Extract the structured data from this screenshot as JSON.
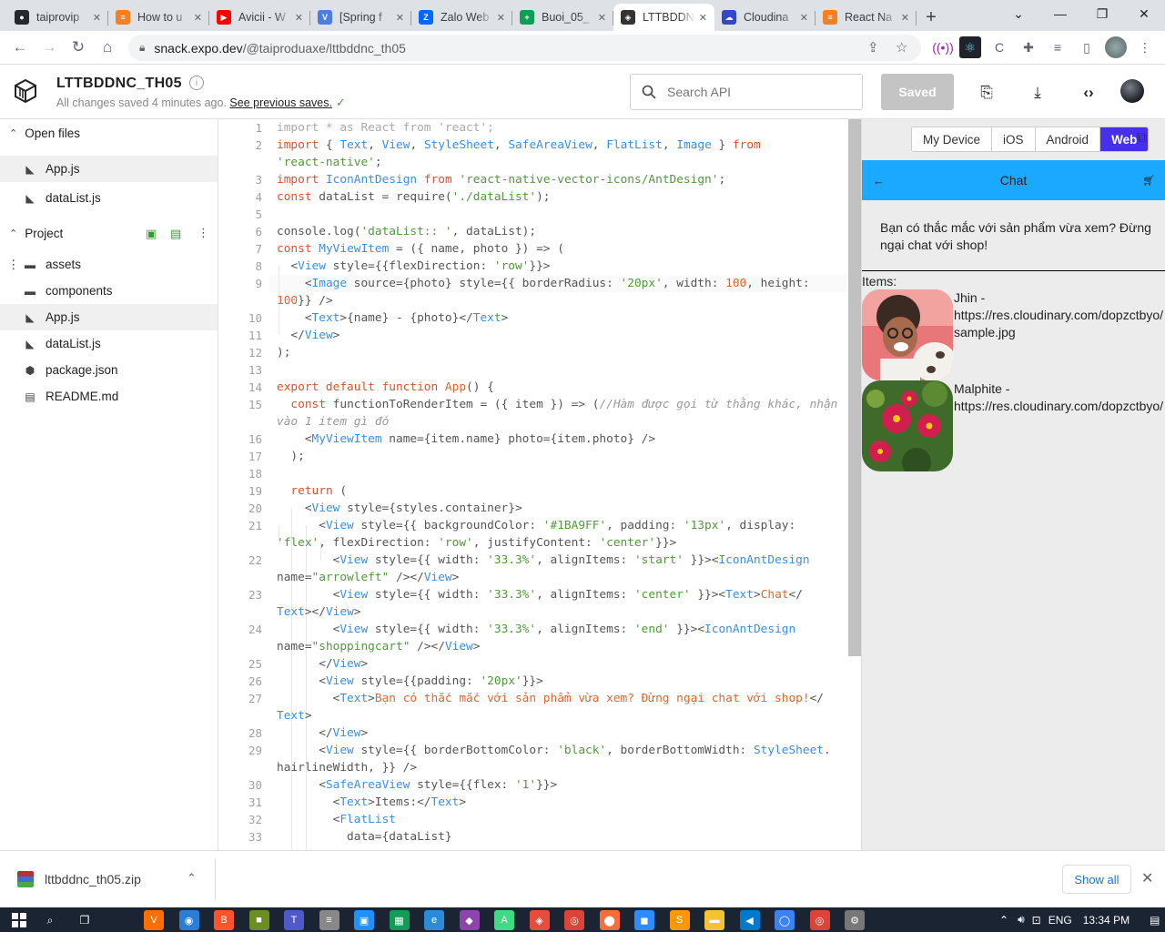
{
  "browser": {
    "tabs": [
      {
        "title": "taiprovip",
        "color": "#24292f",
        "glyph": "●"
      },
      {
        "title": "How to u",
        "color": "#f48024",
        "glyph": "≡"
      },
      {
        "title": "Avicii - W",
        "color": "#ff0000",
        "glyph": "▶"
      },
      {
        "title": "[Spring f",
        "color": "#4a7ee0",
        "glyph": "V"
      },
      {
        "title": "Zalo Web",
        "color": "#0068ff",
        "glyph": "Z"
      },
      {
        "title": "Buoi_05_",
        "color": "#0f9d58",
        "glyph": "+"
      },
      {
        "title": "LTTBDDN",
        "color": "#333333",
        "glyph": "◈"
      },
      {
        "title": "Cloudina",
        "color": "#3448c5",
        "glyph": "☁"
      },
      {
        "title": "React Na",
        "color": "#f48024",
        "glyph": "≡"
      }
    ],
    "url_host": "snack.expo.dev",
    "url_path": "/@taiproduaxe/lttbddnc_th05"
  },
  "snack": {
    "project_name": "LTTBDDNC_TH05",
    "saved_text": "All changes saved 4 minutes ago.",
    "saves_link": "See previous saves.",
    "search_placeholder": "Search API",
    "save_button": "Saved"
  },
  "sidebar": {
    "open_files_label": "Open files",
    "open_files": [
      "App.js",
      "dataList.js"
    ],
    "project_label": "Project",
    "project_items": [
      {
        "name": "assets",
        "type": "folder"
      },
      {
        "name": "components",
        "type": "folder"
      },
      {
        "name": "App.js",
        "type": "js"
      },
      {
        "name": "dataList.js",
        "type": "js"
      },
      {
        "name": "package.json",
        "type": "pkg"
      },
      {
        "name": "README.md",
        "type": "md"
      }
    ]
  },
  "editor": {
    "line_numbers": [
      "1",
      "2",
      "",
      "3",
      "4",
      "5",
      "6",
      "7",
      "8",
      "9",
      "",
      "10",
      "11",
      "12",
      "13",
      "14",
      "15",
      "",
      "16",
      "17",
      "18",
      "19",
      "20",
      "21",
      "",
      "22",
      "",
      "23",
      "",
      "24",
      "",
      "25",
      "26",
      "27",
      "",
      "28",
      "29",
      "",
      "30",
      "31",
      "32",
      "33"
    ]
  },
  "preview": {
    "platforms": [
      "My Device",
      "iOS",
      "Android",
      "Web"
    ],
    "active_platform": "Web",
    "header_title": "Chat",
    "question": "Bạn có thắc mắc với sản phẩm vừa xem? Đừng ngại chat với shop!",
    "items_label": "Items:",
    "items": [
      {
        "name": "Jhin -",
        "url1": "https://res.cloudinary.com/dopzctbyo/",
        "url2": "sample.jpg"
      },
      {
        "name": "Malphite -",
        "url1": "https://res.cloudinary.com/dopzctbyo/",
        "url2": ""
      }
    ]
  },
  "downloads": {
    "file": "lttbddnc_th05.zip",
    "show_all": "Show all"
  },
  "taskbar": {
    "time": "13:34 PM"
  }
}
